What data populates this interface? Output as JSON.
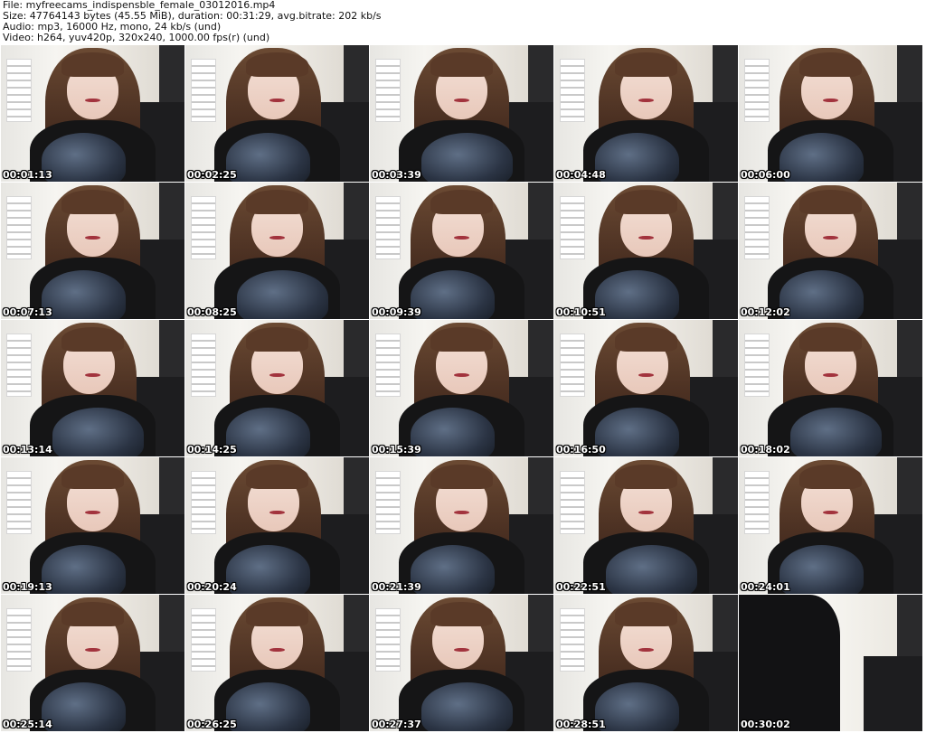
{
  "header": {
    "file_line": "File: myfreecams_indispensble_female_03012016.mp4",
    "size_line": "Size: 47764143 bytes (45.55 MiB), duration: 00:31:29, avg.bitrate: 202 kb/s",
    "audio_line": "Audio: mp3, 16000 Hz, mono, 24 kb/s (und)",
    "video_line": "Video: h264, yuv420p, 320x240, 1000.00 fps(r) (und)"
  },
  "thumbnails": [
    {
      "timestamp": "00:01:13"
    },
    {
      "timestamp": "00:02:25"
    },
    {
      "timestamp": "00:03:39"
    },
    {
      "timestamp": "00:04:48"
    },
    {
      "timestamp": "00:06:00"
    },
    {
      "timestamp": "00:07:13"
    },
    {
      "timestamp": "00:08:25"
    },
    {
      "timestamp": "00:09:39"
    },
    {
      "timestamp": "00:10:51"
    },
    {
      "timestamp": "00:12:02"
    },
    {
      "timestamp": "00:13:14"
    },
    {
      "timestamp": "00:14:25"
    },
    {
      "timestamp": "00:15:39"
    },
    {
      "timestamp": "00:16:50"
    },
    {
      "timestamp": "00:18:02"
    },
    {
      "timestamp": "00:19:13"
    },
    {
      "timestamp": "00:20:24"
    },
    {
      "timestamp": "00:21:39"
    },
    {
      "timestamp": "00:22:51"
    },
    {
      "timestamp": "00:24:01"
    },
    {
      "timestamp": "00:25:14"
    },
    {
      "timestamp": "00:26:25"
    },
    {
      "timestamp": "00:27:37"
    },
    {
      "timestamp": "00:28:51"
    },
    {
      "timestamp": "00:30:02"
    }
  ]
}
